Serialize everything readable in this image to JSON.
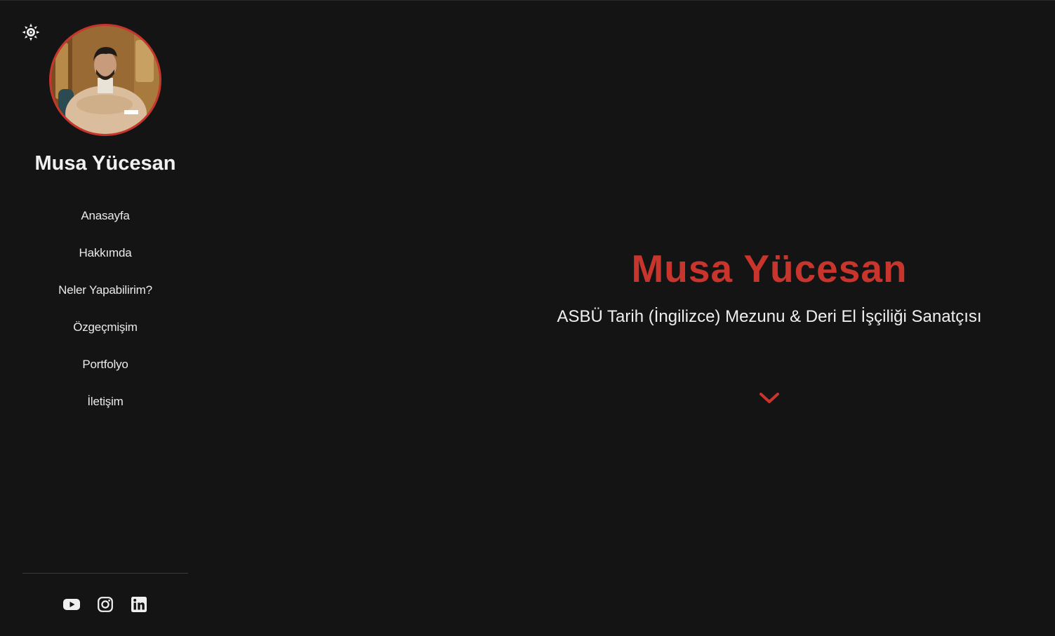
{
  "theme": {
    "accent": "#c8352d",
    "background": "#141414",
    "text": "#f0f0f0",
    "toggle_icon": "sun-icon"
  },
  "sidebar": {
    "name": "Musa Yücesan",
    "avatar_icon": "profile-photo",
    "nav": [
      {
        "label": "Anasayfa"
      },
      {
        "label": "Hakkımda"
      },
      {
        "label": "Neler Yapabilirim?"
      },
      {
        "label": "Özgeçmişim"
      },
      {
        "label": "Portfolyo"
      },
      {
        "label": "İletişim"
      }
    ],
    "socials": [
      {
        "icon": "youtube-icon"
      },
      {
        "icon": "instagram-icon"
      },
      {
        "icon": "linkedin-icon"
      }
    ]
  },
  "hero": {
    "title": "Musa Yücesan",
    "subtitle": "ASBÜ Tarih (İngilizce) Mezunu & Deri El İşçiliği Sanatçısı",
    "scroll_icon": "chevron-down-icon"
  }
}
